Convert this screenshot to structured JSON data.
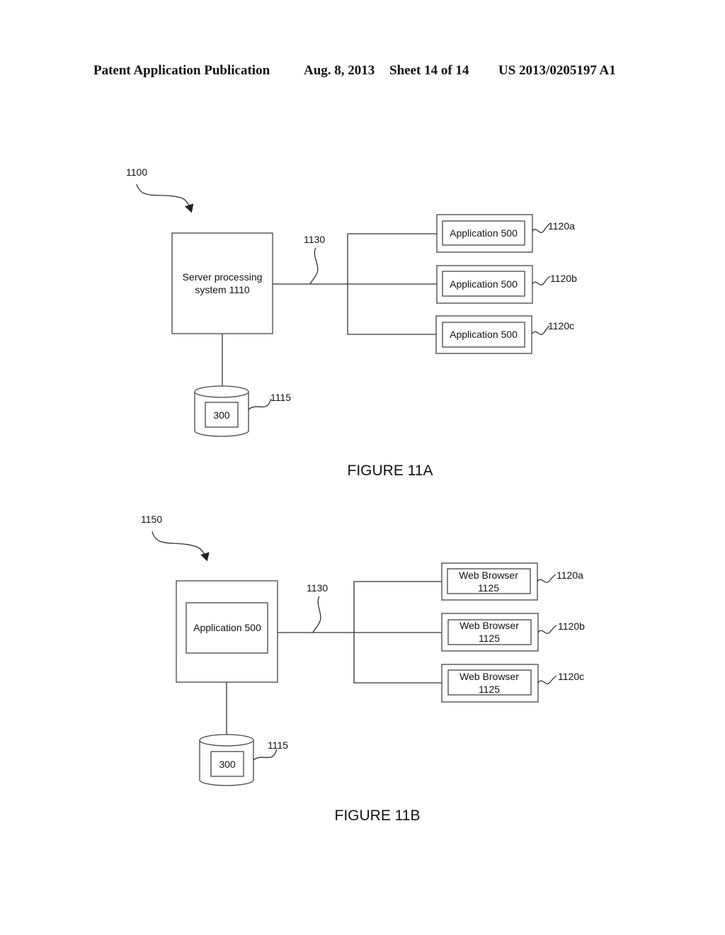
{
  "header": {
    "publication": "Patent Application Publication",
    "date": "Aug. 8, 2013",
    "sheet": "Sheet 14 of 14",
    "pub_number": "US 2013/0205197 A1"
  },
  "figure_a": {
    "caption": "FIGURE 11A",
    "system_ref": "1100",
    "server_line1": "Server processing",
    "server_line2": "system 1110",
    "network_ref": "1130",
    "clients": [
      {
        "label": "Application 500",
        "ref": "1120a"
      },
      {
        "label": "Application 500",
        "ref": "1120b"
      },
      {
        "label": "Application 500",
        "ref": "1120c"
      }
    ],
    "db_label": "300",
    "db_ref": "1115"
  },
  "figure_b": {
    "caption": "FIGURE 11B",
    "system_ref": "1150",
    "server_inner": "Application 500",
    "network_ref": "1130",
    "clients": [
      {
        "line1": "Web Browser",
        "line2": "1125",
        "ref": "1120a"
      },
      {
        "line1": "Web Browser",
        "line2": "1125",
        "ref": "1120b"
      },
      {
        "line1": "Web Browser",
        "line2": "1125",
        "ref": "1120c"
      }
    ],
    "db_label": "300",
    "db_ref": "1115"
  }
}
